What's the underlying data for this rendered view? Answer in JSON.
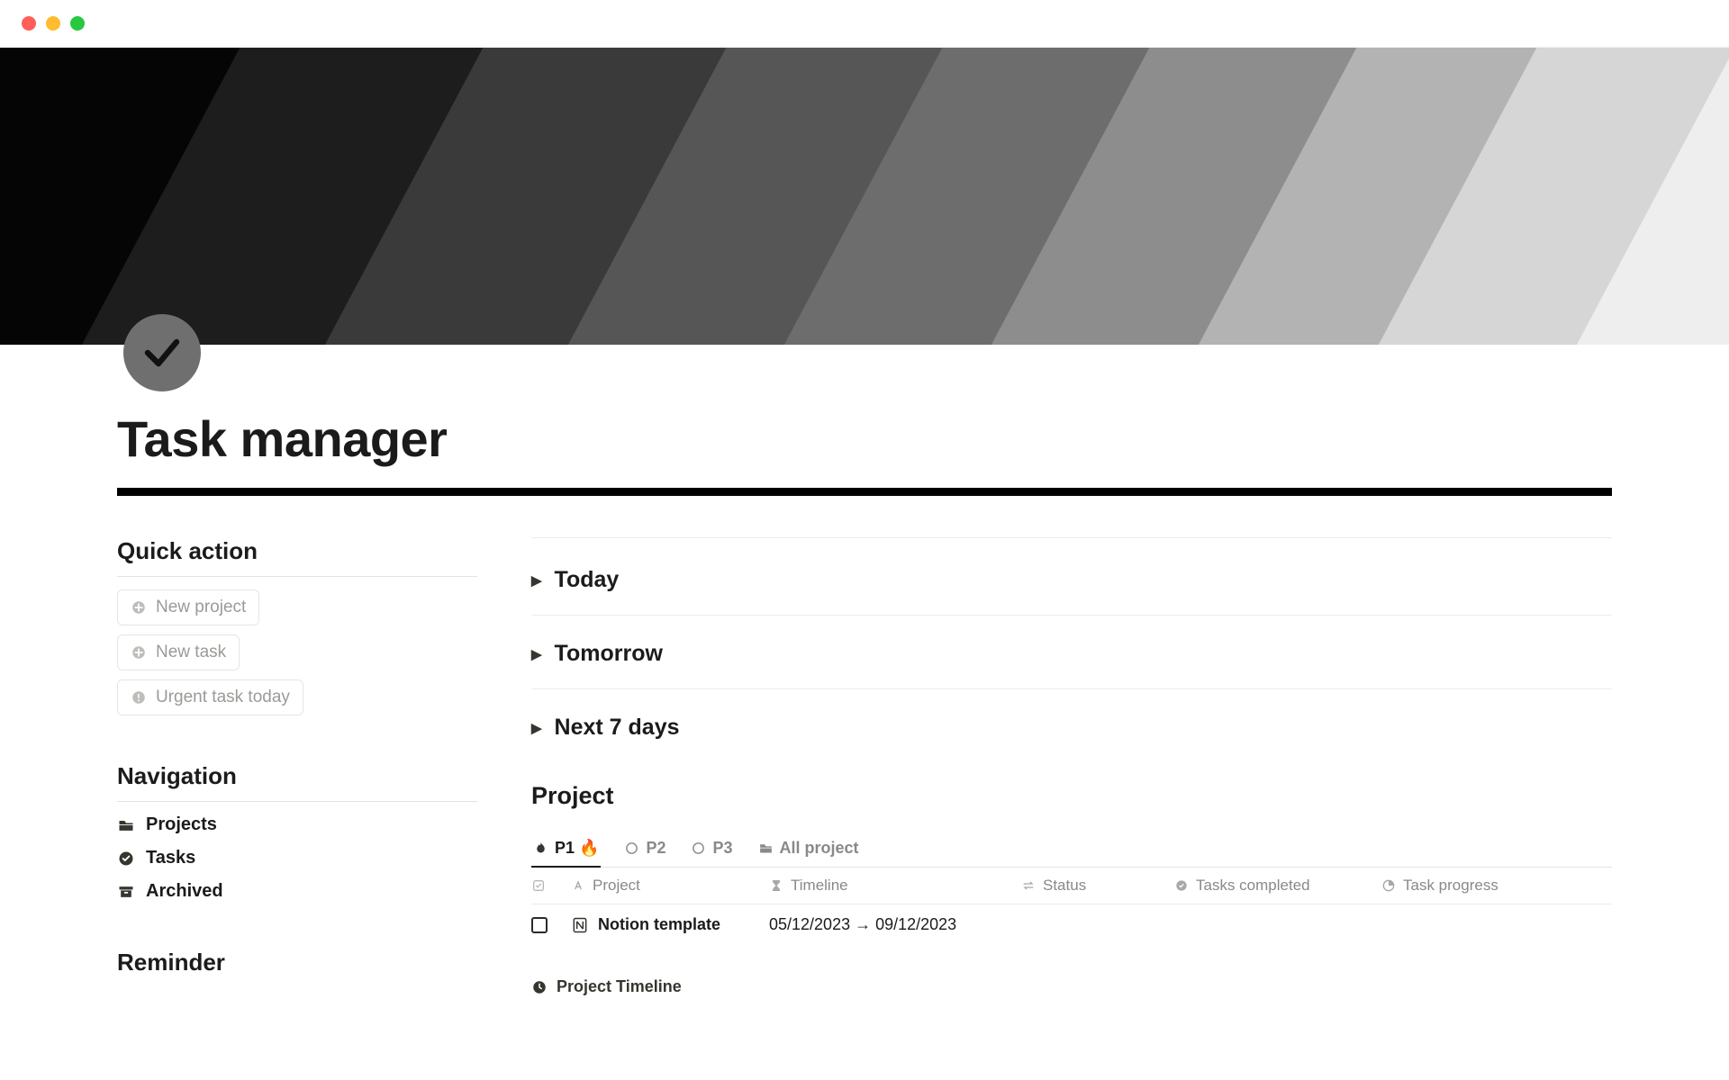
{
  "page": {
    "title": "Task manager"
  },
  "sidebar": {
    "quick_action_heading": "Quick action",
    "navigation_heading": "Navigation",
    "reminder_heading": "Reminder",
    "quick_actions": [
      {
        "label": "New project"
      },
      {
        "label": "New task"
      },
      {
        "label": "Urgent task today"
      }
    ],
    "nav": [
      {
        "label": "Projects"
      },
      {
        "label": "Tasks"
      },
      {
        "label": "Archived"
      }
    ]
  },
  "main": {
    "toggles": [
      {
        "label": "Today"
      },
      {
        "label": "Tomorrow"
      },
      {
        "label": "Next 7 days"
      }
    ],
    "project_heading": "Project",
    "tabs": [
      {
        "label": "P1 🔥",
        "active": true
      },
      {
        "label": "P2"
      },
      {
        "label": "P3"
      },
      {
        "label": "All project"
      }
    ],
    "columns": {
      "project": "Project",
      "timeline": "Timeline",
      "status": "Status",
      "tasks_completed": "Tasks completed",
      "task_progress": "Task progress"
    },
    "rows": [
      {
        "name": "Notion template",
        "timeline": "05/12/2023 → 09/12/2023"
      }
    ],
    "project_timeline_label": "Project Timeline"
  }
}
